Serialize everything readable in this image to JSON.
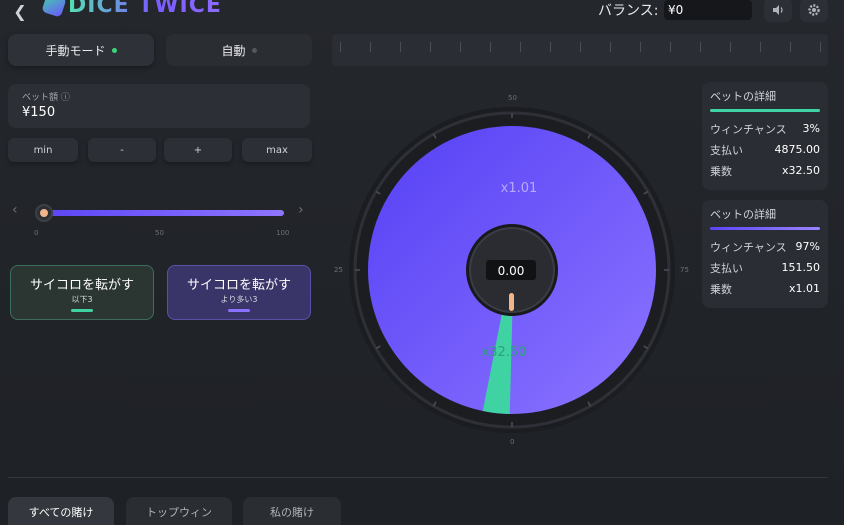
{
  "header": {
    "logo_text": "DICE TWICE",
    "balance_label": "バランス:",
    "balance_value": "¥0",
    "back_icon": "chevron-left-icon",
    "sound_icon": "speaker-icon",
    "settings_icon": "gear-icon"
  },
  "modes": {
    "manual_label": "手動モード",
    "auto_label": "自動",
    "manual_dot_color": "#3fd37a",
    "auto_dot_color": "#55595f"
  },
  "bet": {
    "label": "ベット額 ⓘ",
    "value": "¥150",
    "buttons": {
      "min": "min",
      "minus": "-",
      "plus": "+",
      "max": "max"
    }
  },
  "slider": {
    "value_percent": 0,
    "labels": {
      "start": "0",
      "mid": "50",
      "end": "100"
    }
  },
  "roll_buttons": {
    "under": {
      "title": "サイコロを転がす",
      "subtitle": "以下3",
      "accent": "#3fd3a4"
    },
    "over": {
      "title": "サイコロを転がす",
      "subtitle": "より多い3",
      "accent": "#8a72ff"
    }
  },
  "wheel": {
    "result": "0.00",
    "high_multiplier": "x1.01",
    "low_multiplier": "x32.50",
    "marks": {
      "top": "50",
      "left": "25",
      "right": "75",
      "bottom": "0"
    },
    "purple": "#6a53ff",
    "green": "#3fd3a4"
  },
  "details": [
    {
      "title": "ベットの詳細",
      "accent": "#3fd3a4",
      "rows": [
        {
          "key": "ウィンチャンス",
          "value": "3%"
        },
        {
          "key": "支払い",
          "value": "4875.00"
        },
        {
          "key": "乗数",
          "value": "x32.50"
        }
      ]
    },
    {
      "title": "ベットの詳細",
      "accent": "#8a72ff",
      "rows": [
        {
          "key": "ウィンチャンス",
          "value": "97%"
        },
        {
          "key": "支払い",
          "value": "151.50"
        },
        {
          "key": "乗数",
          "value": "x1.01"
        }
      ]
    }
  ],
  "bottom_tabs": {
    "all": "すべての賭け",
    "top": "トップウィン",
    "mine": "私の賭け"
  }
}
